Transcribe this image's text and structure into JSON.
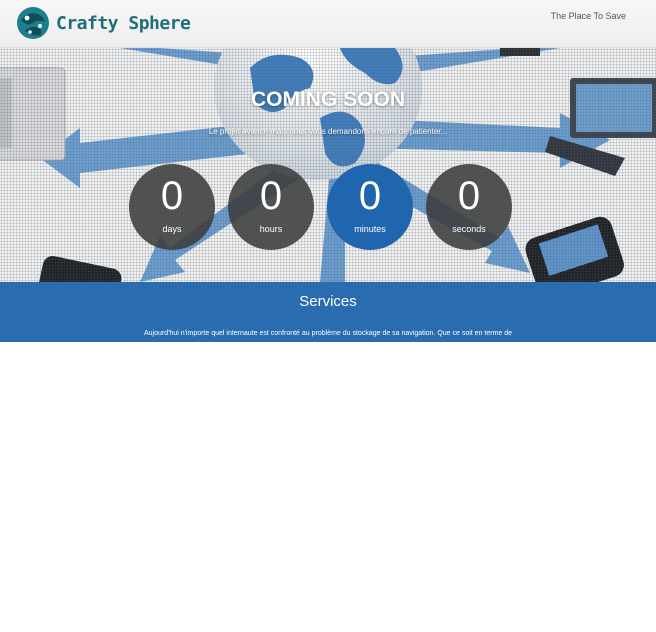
{
  "brand": {
    "name": "Crafty Sphere",
    "tagline": "The Place To Save"
  },
  "hero": {
    "title": "COMING SOON",
    "subtitle": "Le projet avance mais nous vous demandons encore de patienter..."
  },
  "countdown": [
    {
      "value": "0",
      "unit": "days"
    },
    {
      "value": "0",
      "unit": "hours"
    },
    {
      "value": "0",
      "unit": "minutes"
    },
    {
      "value": "0",
      "unit": "seconds"
    }
  ],
  "services": {
    "title": "Services",
    "text": "Aujourd'hui n'importe quel internaute est confronté au problème du stockage de sa navigation. Que ce soit en terme de"
  },
  "colors": {
    "brand_teal": "#1d6f7c",
    "highlight_blue": "#1f66ae",
    "services_bg": "#2a6cb0"
  }
}
